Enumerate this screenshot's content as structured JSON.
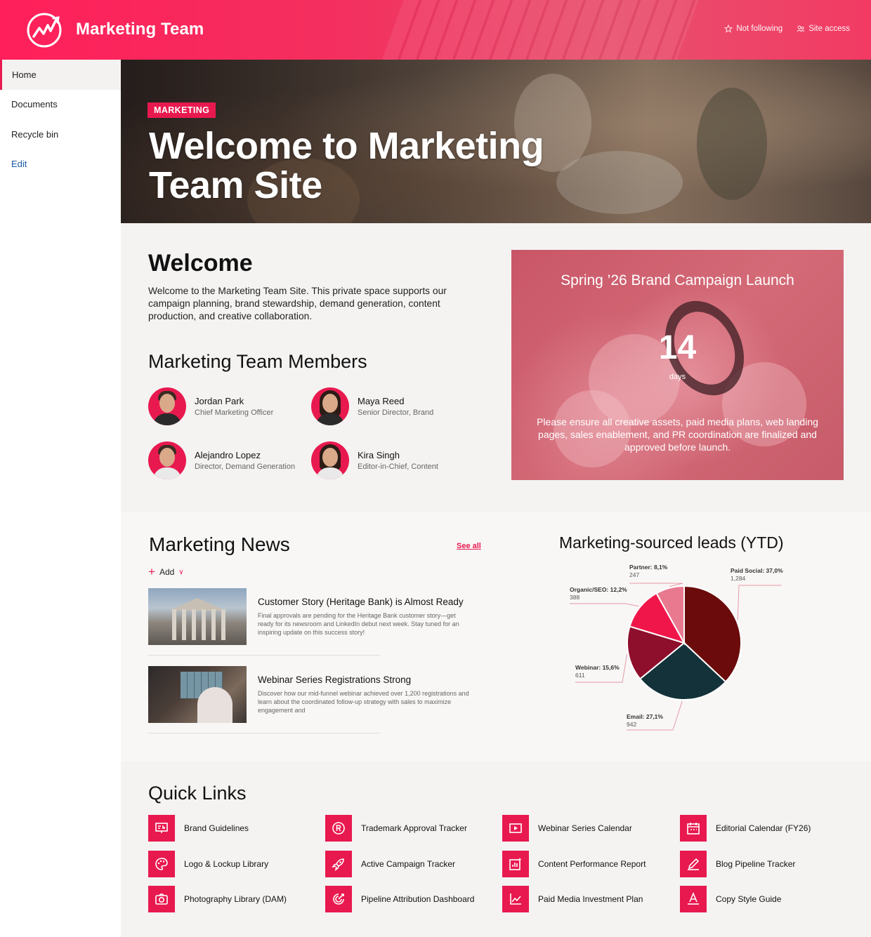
{
  "site": {
    "title": "Marketing Team",
    "actions": {
      "follow": "Not following",
      "access": "Site access"
    }
  },
  "nav": {
    "items": [
      {
        "label": "Home",
        "active": true
      },
      {
        "label": "Documents"
      },
      {
        "label": "Recycle bin"
      },
      {
        "label": "Edit"
      }
    ]
  },
  "hero": {
    "tag": "MARKETING",
    "title": "Welcome to Marketing Team Site"
  },
  "welcome": {
    "heading": "Welcome",
    "body": "Welcome to the Marketing Team Site. This private space supports our campaign planning, brand stewardship, demand generation, content production, and creative collaboration."
  },
  "members": {
    "heading": "Marketing Team Members",
    "people": [
      {
        "name": "Jordan Park",
        "role": "Chief Marketing Officer"
      },
      {
        "name": "Maya Reed",
        "role": "Senior Director, Brand"
      },
      {
        "name": "Alejandro Lopez",
        "role": "Director, Demand Generation"
      },
      {
        "name": "Kira Singh",
        "role": "Editor-in-Chief, Content"
      }
    ]
  },
  "countdown": {
    "title": "Spring ’26 Brand Campaign Launch",
    "number": "14",
    "unit": "days",
    "message": "Please ensure all creative assets, paid media plans, web landing pages, sales enablement, and PR coordination are finalized and approved before launch."
  },
  "news": {
    "heading": "Marketing News",
    "see_all": "See all",
    "add": "Add",
    "items": [
      {
        "title": "Customer Story (Heritage Bank) is Almost Ready",
        "desc": "Final approvals are pending for the Heritage Bank customer story—get ready for its newsroom and LinkedIn debut next week. Stay tuned for an inspiring update on this success story!"
      },
      {
        "title": "Webinar Series Registrations Strong",
        "desc": "Discover how our mid-funnel webinar achieved over 1,200 registrations and learn about the coordinated follow-up strategy with sales to maximize engagement and"
      }
    ]
  },
  "chart_data": {
    "type": "pie",
    "title": "Marketing-sourced leads (YTD)",
    "slices": [
      {
        "label": "Paid Social: 37,0%",
        "count": "1,284",
        "value": 37.0,
        "color": "#6b0b0b"
      },
      {
        "label": "Email: 27,1%",
        "count": "942",
        "value": 27.1,
        "color": "#13323a"
      },
      {
        "label": "Webinar: 15,6%",
        "count": "611",
        "value": 15.6,
        "color": "#8e0f2c"
      },
      {
        "label": "Organic/SEO: 12,2%",
        "count": "388",
        "value": 12.2,
        "color": "#f0164a"
      },
      {
        "label": "Partner: 8,1%",
        "count": "247",
        "value": 8.1,
        "color": "#e9798f"
      }
    ]
  },
  "quick_links": {
    "heading": "Quick Links",
    "items": [
      {
        "label": "Brand Guidelines",
        "icon": "presentation-icon"
      },
      {
        "label": "Trademark Approval Tracker",
        "icon": "registered-icon"
      },
      {
        "label": "Webinar Series Calendar",
        "icon": "video-icon"
      },
      {
        "label": "Editorial Calendar (FY26)",
        "icon": "calendar-icon"
      },
      {
        "label": "Logo & Lockup Library",
        "icon": "palette-icon"
      },
      {
        "label": "Active Campaign Tracker",
        "icon": "rocket-icon"
      },
      {
        "label": "Content Performance Report",
        "icon": "chart-sparkle-icon"
      },
      {
        "label": "Blog Pipeline Tracker",
        "icon": "pen-icon"
      },
      {
        "label": "Photography Library (DAM)",
        "icon": "camera-icon"
      },
      {
        "label": "Pipeline Attribution Dashboard",
        "icon": "target-icon"
      },
      {
        "label": "Paid Media Investment Plan",
        "icon": "line-chart-icon"
      },
      {
        "label": "Copy Style Guide",
        "icon": "text-style-icon"
      }
    ]
  }
}
